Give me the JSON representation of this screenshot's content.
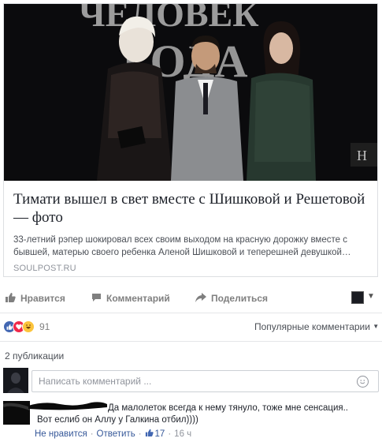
{
  "post": {
    "link_title": "Тимати вышел в свет вместе с Шишковой и Решетовой — фото",
    "link_description": "33-летний рэпер шокировал всех своим выходом на красную дорожку вместе с бывшей, матерью своего ребенка Аленой Шишковой и теперешней девушкой…",
    "link_domain": "SOULPOST.RU",
    "photo_backdrop_text": "ЧЕЛОВЕК\nГОДА"
  },
  "actions": {
    "like": "Нравится",
    "comment": "Комментарий",
    "share": "Поделиться"
  },
  "reactions": {
    "count": "91",
    "types": [
      "like-icon",
      "love-icon",
      "haha-icon"
    ],
    "popular_label": "Популярные комментарии"
  },
  "comments": {
    "count_label": "2 публикации",
    "composer_placeholder": "Написать комментарий ...",
    "items": [
      {
        "line1": "Да малолеток всегда к нему тянуло, тоже мне сенсация..",
        "line2": "Вот еслиб он Аллу у Галкина отбил))))",
        "unlike": "Не нравится",
        "reply": "Ответить",
        "likes": "17",
        "time": "16 ч"
      }
    ]
  },
  "colors": {
    "fb_blue": "#4267b2",
    "link_blue": "#365899",
    "grey_text": "#7f7f7f",
    "border": "#dddfe2"
  }
}
